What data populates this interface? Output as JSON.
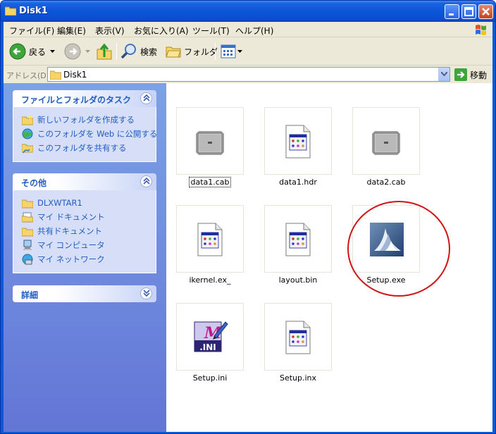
{
  "window": {
    "title": "Disk1",
    "minimize_label": "_",
    "maximize_label": "□",
    "close_label": "✕"
  },
  "menu": {
    "items": [
      {
        "label": "ファイル(F)"
      },
      {
        "label": "編集(E)"
      },
      {
        "label": "表示(V)"
      },
      {
        "label": "お気に入り(A)"
      },
      {
        "label": "ツール(T)"
      },
      {
        "label": "ヘルプ(H)"
      }
    ]
  },
  "toolbar": {
    "back_label": "戻る",
    "search_label": "検索",
    "folders_label": "フォルダ"
  },
  "address": {
    "label": "アドレス(D)",
    "value": "Disk1",
    "go_label": "移動"
  },
  "left_pane": {
    "tasks_panel": {
      "title": "ファイルとフォルダのタスク",
      "items": [
        {
          "label": "新しいフォルダを作成する"
        },
        {
          "label": "このフォルダを Web に公開する"
        },
        {
          "label": "このフォルダを共有する"
        }
      ]
    },
    "other_panel": {
      "title": "その他",
      "items": [
        {
          "label": "DLXWTAR1"
        },
        {
          "label": "マイ ドキュメント"
        },
        {
          "label": "共有ドキュメント"
        },
        {
          "label": "マイ コンピュータ"
        },
        {
          "label": "マイ ネットワーク"
        }
      ]
    },
    "details_panel": {
      "title": "詳細"
    }
  },
  "files": [
    {
      "name": "data1.cab",
      "icon": "cabinet-icon"
    },
    {
      "name": "data1.hdr",
      "icon": "document-icon"
    },
    {
      "name": "data2.cab",
      "icon": "cabinet-icon"
    },
    {
      "name": "ikernel.ex_",
      "icon": "document-icon"
    },
    {
      "name": "layout.bin",
      "icon": "document-icon"
    },
    {
      "name": "Setup.exe",
      "icon": "installer-icon"
    },
    {
      "name": "Setup.ini",
      "icon": "ini-file-icon"
    },
    {
      "name": "Setup.inx",
      "icon": "document-icon"
    }
  ],
  "colors": {
    "titlebar": "#0a56d8",
    "task_link": "#215dc6",
    "highlight_circle": "#d01414"
  }
}
